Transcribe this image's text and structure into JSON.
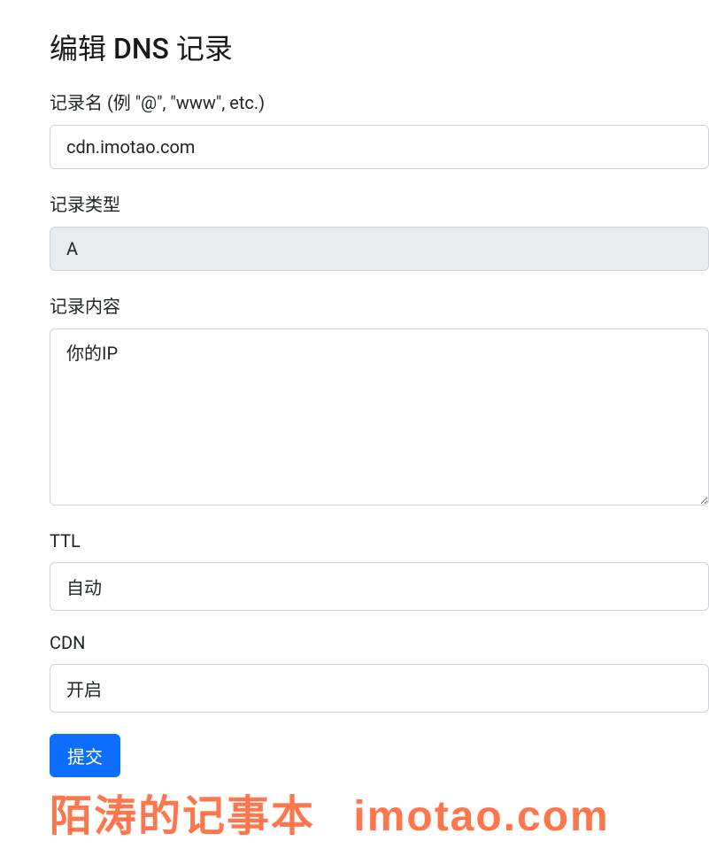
{
  "title": "编辑 DNS 记录",
  "fields": {
    "name": {
      "label": "记录名 (例 \"@\", \"www\", etc.)",
      "value": "cdn.imotao.com"
    },
    "type": {
      "label": "记录类型",
      "value": "A"
    },
    "content": {
      "label": "记录内容",
      "value": "你的IP"
    },
    "ttl": {
      "label": "TTL",
      "value": "自动"
    },
    "cdn": {
      "label": "CDN",
      "value": "开启"
    }
  },
  "submit_label": "提交",
  "watermark": {
    "text": "陌涛的记事本",
    "domain": "imotao.com"
  }
}
